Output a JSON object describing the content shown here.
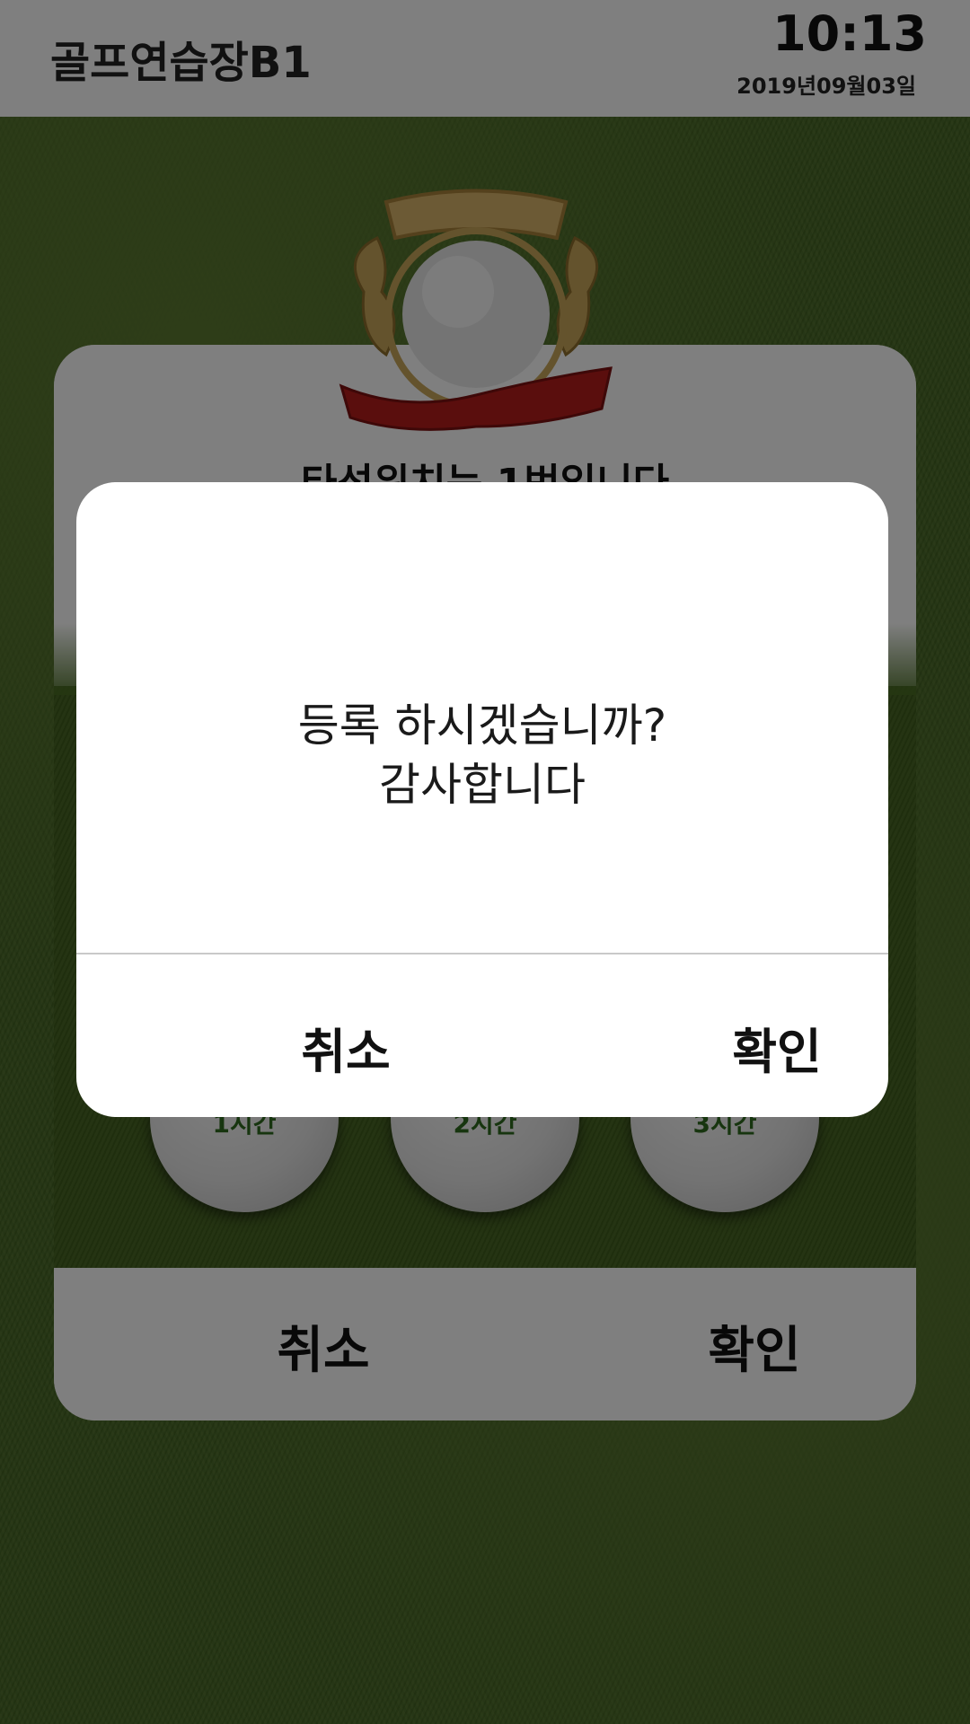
{
  "header": {
    "app_title": "골프연습장B1",
    "time": "10:13",
    "date": "2019년09월03일"
  },
  "panel": {
    "title": "타석위치는 1번입니다",
    "options": [
      "1시간",
      "2시간",
      "3시간"
    ],
    "cancel_label": "취소",
    "confirm_label": "확인"
  },
  "dialog": {
    "message_line1": "등록 하시겠습니까?",
    "message_line2": "감사합니다",
    "cancel_label": "취소",
    "confirm_label": "확인"
  },
  "icons": {
    "emblem": "golf-ball-crest-icon"
  },
  "colors": {
    "grass": "#4a6b26",
    "overlay": "rgba(0,0,0,0.5)",
    "option_text": "#2f6a1f"
  }
}
